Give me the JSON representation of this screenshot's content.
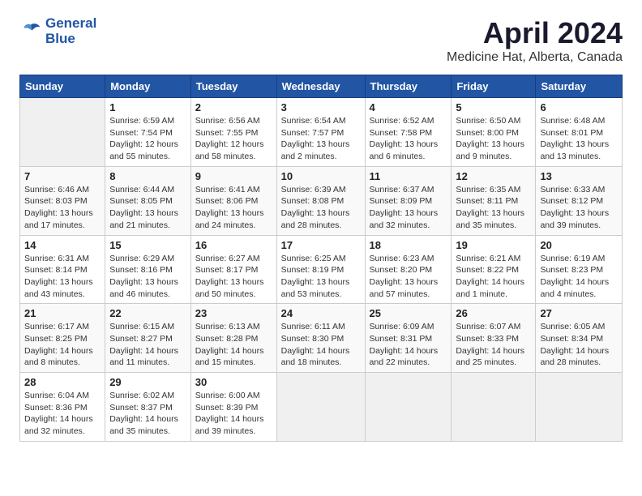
{
  "logo": {
    "line1": "General",
    "line2": "Blue"
  },
  "title": "April 2024",
  "subtitle": "Medicine Hat, Alberta, Canada",
  "days_of_week": [
    "Sunday",
    "Monday",
    "Tuesday",
    "Wednesday",
    "Thursday",
    "Friday",
    "Saturday"
  ],
  "weeks": [
    [
      {
        "num": "",
        "info": ""
      },
      {
        "num": "1",
        "info": "Sunrise: 6:59 AM\nSunset: 7:54 PM\nDaylight: 12 hours\nand 55 minutes."
      },
      {
        "num": "2",
        "info": "Sunrise: 6:56 AM\nSunset: 7:55 PM\nDaylight: 12 hours\nand 58 minutes."
      },
      {
        "num": "3",
        "info": "Sunrise: 6:54 AM\nSunset: 7:57 PM\nDaylight: 13 hours\nand 2 minutes."
      },
      {
        "num": "4",
        "info": "Sunrise: 6:52 AM\nSunset: 7:58 PM\nDaylight: 13 hours\nand 6 minutes."
      },
      {
        "num": "5",
        "info": "Sunrise: 6:50 AM\nSunset: 8:00 PM\nDaylight: 13 hours\nand 9 minutes."
      },
      {
        "num": "6",
        "info": "Sunrise: 6:48 AM\nSunset: 8:01 PM\nDaylight: 13 hours\nand 13 minutes."
      }
    ],
    [
      {
        "num": "7",
        "info": "Sunrise: 6:46 AM\nSunset: 8:03 PM\nDaylight: 13 hours\nand 17 minutes."
      },
      {
        "num": "8",
        "info": "Sunrise: 6:44 AM\nSunset: 8:05 PM\nDaylight: 13 hours\nand 21 minutes."
      },
      {
        "num": "9",
        "info": "Sunrise: 6:41 AM\nSunset: 8:06 PM\nDaylight: 13 hours\nand 24 minutes."
      },
      {
        "num": "10",
        "info": "Sunrise: 6:39 AM\nSunset: 8:08 PM\nDaylight: 13 hours\nand 28 minutes."
      },
      {
        "num": "11",
        "info": "Sunrise: 6:37 AM\nSunset: 8:09 PM\nDaylight: 13 hours\nand 32 minutes."
      },
      {
        "num": "12",
        "info": "Sunrise: 6:35 AM\nSunset: 8:11 PM\nDaylight: 13 hours\nand 35 minutes."
      },
      {
        "num": "13",
        "info": "Sunrise: 6:33 AM\nSunset: 8:12 PM\nDaylight: 13 hours\nand 39 minutes."
      }
    ],
    [
      {
        "num": "14",
        "info": "Sunrise: 6:31 AM\nSunset: 8:14 PM\nDaylight: 13 hours\nand 43 minutes."
      },
      {
        "num": "15",
        "info": "Sunrise: 6:29 AM\nSunset: 8:16 PM\nDaylight: 13 hours\nand 46 minutes."
      },
      {
        "num": "16",
        "info": "Sunrise: 6:27 AM\nSunset: 8:17 PM\nDaylight: 13 hours\nand 50 minutes."
      },
      {
        "num": "17",
        "info": "Sunrise: 6:25 AM\nSunset: 8:19 PM\nDaylight: 13 hours\nand 53 minutes."
      },
      {
        "num": "18",
        "info": "Sunrise: 6:23 AM\nSunset: 8:20 PM\nDaylight: 13 hours\nand 57 minutes."
      },
      {
        "num": "19",
        "info": "Sunrise: 6:21 AM\nSunset: 8:22 PM\nDaylight: 14 hours\nand 1 minute."
      },
      {
        "num": "20",
        "info": "Sunrise: 6:19 AM\nSunset: 8:23 PM\nDaylight: 14 hours\nand 4 minutes."
      }
    ],
    [
      {
        "num": "21",
        "info": "Sunrise: 6:17 AM\nSunset: 8:25 PM\nDaylight: 14 hours\nand 8 minutes."
      },
      {
        "num": "22",
        "info": "Sunrise: 6:15 AM\nSunset: 8:27 PM\nDaylight: 14 hours\nand 11 minutes."
      },
      {
        "num": "23",
        "info": "Sunrise: 6:13 AM\nSunset: 8:28 PM\nDaylight: 14 hours\nand 15 minutes."
      },
      {
        "num": "24",
        "info": "Sunrise: 6:11 AM\nSunset: 8:30 PM\nDaylight: 14 hours\nand 18 minutes."
      },
      {
        "num": "25",
        "info": "Sunrise: 6:09 AM\nSunset: 8:31 PM\nDaylight: 14 hours\nand 22 minutes."
      },
      {
        "num": "26",
        "info": "Sunrise: 6:07 AM\nSunset: 8:33 PM\nDaylight: 14 hours\nand 25 minutes."
      },
      {
        "num": "27",
        "info": "Sunrise: 6:05 AM\nSunset: 8:34 PM\nDaylight: 14 hours\nand 28 minutes."
      }
    ],
    [
      {
        "num": "28",
        "info": "Sunrise: 6:04 AM\nSunset: 8:36 PM\nDaylight: 14 hours\nand 32 minutes."
      },
      {
        "num": "29",
        "info": "Sunrise: 6:02 AM\nSunset: 8:37 PM\nDaylight: 14 hours\nand 35 minutes."
      },
      {
        "num": "30",
        "info": "Sunrise: 6:00 AM\nSunset: 8:39 PM\nDaylight: 14 hours\nand 39 minutes."
      },
      {
        "num": "",
        "info": ""
      },
      {
        "num": "",
        "info": ""
      },
      {
        "num": "",
        "info": ""
      },
      {
        "num": "",
        "info": ""
      }
    ]
  ]
}
